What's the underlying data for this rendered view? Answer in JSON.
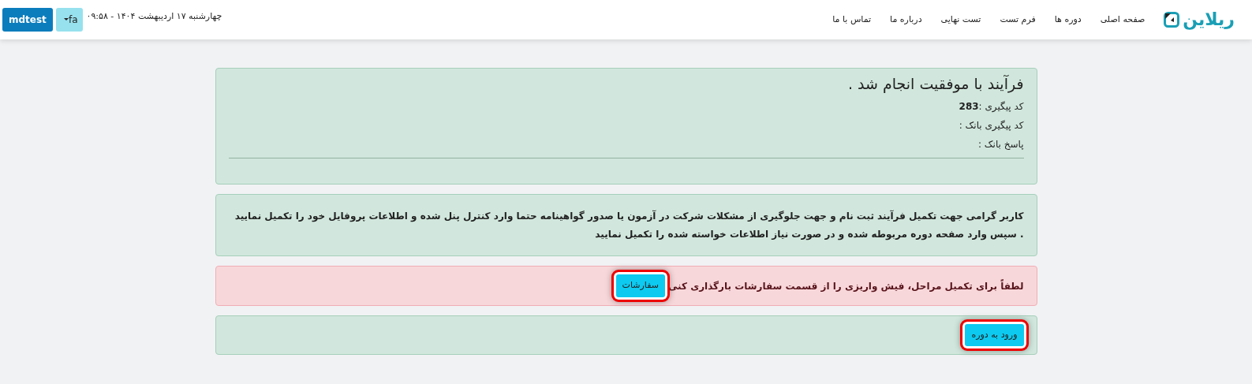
{
  "header": {
    "logo": "ریلاین",
    "nav": [
      {
        "label": "صفحه اصلی"
      },
      {
        "label": "دوره ها"
      },
      {
        "label": "فرم تست"
      },
      {
        "label": "تست نهایی"
      },
      {
        "label": "درباره ما"
      },
      {
        "label": "تماس با ما"
      }
    ],
    "datetime": "چهارشنبه ۱۷ اردیبهشت ۱۴۰۴ - ۰۹:۵۸",
    "language_button": "fa",
    "user_button": "mdtest"
  },
  "result": {
    "title": "فرآیند با موفقیت انجام شد .",
    "lines": [
      "کد پیگیری :**283**",
      "کد پیگیری بانک :",
      "پاسخ بانک :"
    ]
  },
  "notice": "کاربر گرامی جهت تکمیل فرآیند ثبت نام و جهت جلوگیری از مشکلات شرکت در آزمون یا صدور گواهینامه حتما وارد کنترل پنل شده و اطلاعات پروفایل خود را تکمیل نمایید . سپس وارد صفحه دوره مربوطه شده و در صورت نیاز اطلاعات خواسته شده را تکمیل نمایید",
  "warning": {
    "text": "لطفاً برای تکمیل مراحل، فیش واریزی را از قسمت سفارشات بارگذاری کنی",
    "button": {
      "label": "سفارشات",
      "highlighted": true
    }
  },
  "enter": {
    "button": {
      "label": "ورود به دوره",
      "highlighted": true
    }
  }
}
